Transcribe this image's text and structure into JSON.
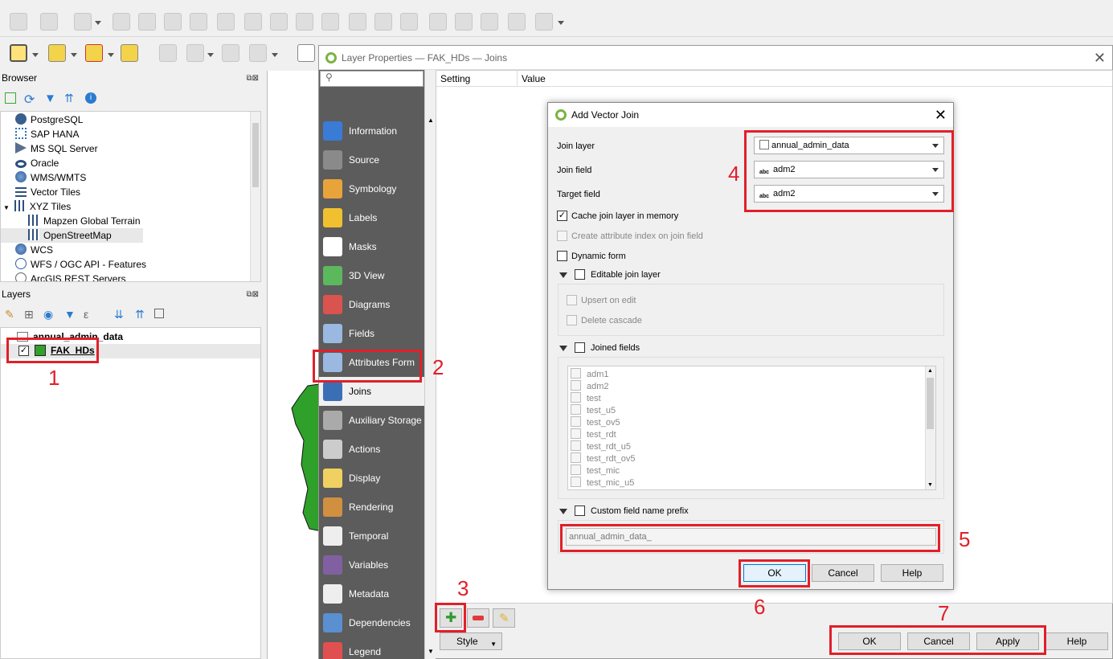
{
  "browser_panel": {
    "title": "Browser",
    "items": [
      {
        "label": "PostgreSQL",
        "icon": "postgresql-icon"
      },
      {
        "label": "SAP HANA",
        "icon": "sap-hana-icon"
      },
      {
        "label": "MS SQL Server",
        "icon": "mssql-icon"
      },
      {
        "label": "Oracle",
        "icon": "oracle-icon"
      },
      {
        "label": "WMS/WMTS",
        "icon": "globe-icon"
      },
      {
        "label": "Vector Tiles",
        "icon": "grid-icon"
      },
      {
        "label": "XYZ Tiles",
        "icon": "grid-icon"
      },
      {
        "label": "Mapzen Global Terrain",
        "icon": "grid-icon"
      },
      {
        "label": "OpenStreetMap",
        "icon": "grid-icon"
      },
      {
        "label": "WCS",
        "icon": "globe-icon"
      },
      {
        "label": "WFS / OGC API - Features",
        "icon": "wfs-icon"
      },
      {
        "label": "ArcGIS REST Servers",
        "icon": "arcgis-icon"
      }
    ]
  },
  "layers_panel": {
    "title": "Layers",
    "layers": [
      {
        "name": "annual_admin_data",
        "checked": false
      },
      {
        "name": "FAK_HDs",
        "checked": true,
        "color": "#33a02c"
      }
    ]
  },
  "layer_properties": {
    "title": "Layer Properties — FAK_HDs — Joins",
    "search_placeholder": "",
    "nav": [
      {
        "label": "Information",
        "icon": "info-icon",
        "color": "#3a7bd5"
      },
      {
        "label": "Source",
        "icon": "source-icon",
        "color": "#8a8a8a"
      },
      {
        "label": "Symbology",
        "icon": "symbology-icon",
        "color": "#e8a33a"
      },
      {
        "label": "Labels",
        "icon": "labels-icon",
        "color": "#f0c030"
      },
      {
        "label": "Masks",
        "icon": "masks-icon",
        "color": "#ffffff"
      },
      {
        "label": "3D View",
        "icon": "cube-icon",
        "color": "#5cb85c"
      },
      {
        "label": "Diagrams",
        "icon": "diagrams-icon",
        "color": "#d9534f"
      },
      {
        "label": "Fields",
        "icon": "fields-icon",
        "color": "#9ab8e0"
      },
      {
        "label": "Attributes Form",
        "icon": "form-icon",
        "color": "#9ab8e0"
      },
      {
        "label": "Joins",
        "icon": "joins-icon",
        "color": "#3a6fb5"
      },
      {
        "label": "Auxiliary Storage",
        "icon": "storage-icon",
        "color": "#aaaaaa"
      },
      {
        "label": "Actions",
        "icon": "actions-icon",
        "color": "#cccccc"
      },
      {
        "label": "Display",
        "icon": "display-icon",
        "color": "#f0d060"
      },
      {
        "label": "Rendering",
        "icon": "rendering-icon",
        "color": "#d09040"
      },
      {
        "label": "Temporal",
        "icon": "clock-icon",
        "color": "#eeeeee"
      },
      {
        "label": "Variables",
        "icon": "variables-icon",
        "color": "#8060a0"
      },
      {
        "label": "Metadata",
        "icon": "metadata-icon",
        "color": "#eeeeee"
      },
      {
        "label": "Dependencies",
        "icon": "dependencies-icon",
        "color": "#5a8fd0"
      },
      {
        "label": "Legend",
        "icon": "legend-icon",
        "color": "#e05050"
      }
    ],
    "selected_nav": "Joins",
    "table_headers": [
      "Setting",
      "Value"
    ],
    "style_label": "Style",
    "buttons": {
      "ok": "OK",
      "cancel": "Cancel",
      "apply": "Apply",
      "help": "Help"
    }
  },
  "add_vector_join": {
    "title": "Add Vector Join",
    "join_layer_label": "Join layer",
    "join_layer_value": "annual_admin_data",
    "join_field_label": "Join field",
    "join_field_value": "adm2",
    "target_field_label": "Target field",
    "target_field_value": "adm2",
    "field_type_badge": "abc",
    "cache_label": "Cache join layer in memory",
    "cache_checked": true,
    "attr_index_label": "Create attribute index on join field",
    "dynamic_form_label": "Dynamic form",
    "editable_join_label": "Editable join layer",
    "upsert_label": "Upsert on edit",
    "delete_cascade_label": "Delete cascade",
    "joined_fields_label": "Joined fields",
    "joined_fields": [
      "adm1",
      "adm2",
      "test",
      "test_u5",
      "test_ov5",
      "test_rdt",
      "test_rdt_u5",
      "test_rdt_ov5",
      "test_mic",
      "test_mic_u5"
    ],
    "custom_prefix_label": "Custom field name prefix",
    "custom_prefix_value": "annual_admin_data_",
    "buttons": {
      "ok": "OK",
      "cancel": "Cancel",
      "help": "Help"
    }
  },
  "annotations": [
    "1",
    "2",
    "3",
    "4",
    "5",
    "6",
    "7"
  ],
  "colors": {
    "annotation_red": "#e0202a",
    "layer_green": "#33a02c",
    "sidebar_bg": "#5c5c5c"
  }
}
